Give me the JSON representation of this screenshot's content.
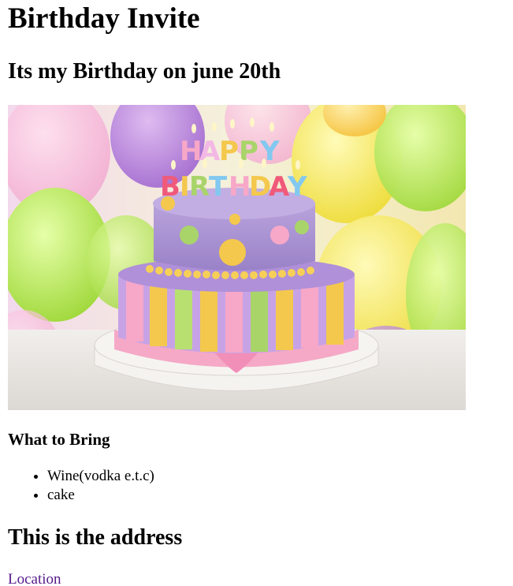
{
  "page": {
    "title": "Birthday Invite",
    "subtitle": "Its my Birthday on june 20th"
  },
  "hero_image": {
    "description_icon": "birthday-cake-image",
    "candle_text": "HAPPY BIRTHDAY",
    "colors": {
      "cake_top": "#b49ad8",
      "cake_bottom": "#c7a3e6",
      "stripe_yellow": "#f4c84c",
      "stripe_green": "#a9d46a",
      "stripe_pink": "#f7a7c8",
      "ribbon": "#f5a9c6",
      "balloon_green": "#b6ea4a",
      "balloon_purple": "#b07ad8",
      "balloon_yellow": "#f6e64a",
      "table": "#eceae6"
    }
  },
  "bring": {
    "heading": "What to Bring",
    "items": [
      "Wine(vodka e.t.c)",
      "cake"
    ]
  },
  "address": {
    "heading": "This is the address",
    "link_label": "Location",
    "link_color": "#551a8b"
  }
}
